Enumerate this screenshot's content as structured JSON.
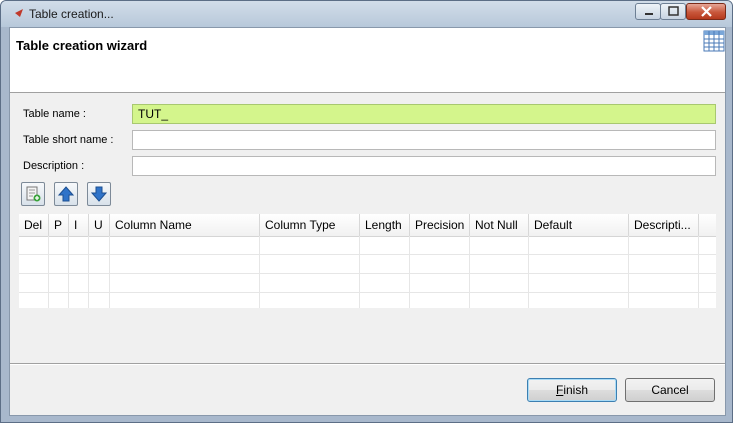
{
  "window": {
    "title": "Table creation...",
    "controls": [
      "minimize-icon",
      "maximize-icon",
      "close-icon"
    ]
  },
  "wizard": {
    "title": "Table creation wizard",
    "icon": "table-grid-icon"
  },
  "form": {
    "table_name_label": "Table name :",
    "table_name_value": "TUT_",
    "short_name_label": "Table short name :",
    "short_name_value": "",
    "description_label": "Description :",
    "description_value": ""
  },
  "toolbar": [
    "add-column-icon",
    "move-up-icon",
    "move-down-icon"
  ],
  "columns_table": {
    "headers": [
      "Del",
      "P",
      "I",
      "U",
      "Column Name",
      "Column Type",
      "Length",
      "Precision",
      "Not Null",
      "Default",
      "Descripti..."
    ],
    "rows": []
  },
  "buttons": {
    "finish_first": "F",
    "finish_rest": "inish",
    "cancel": "Cancel"
  },
  "colors": {
    "highlight_field": "#d4f58c",
    "titlebar": "#c2d1e1",
    "close_button": "#c8573b"
  }
}
